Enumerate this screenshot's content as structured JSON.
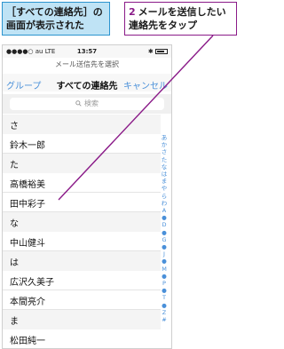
{
  "callouts": {
    "left": "［すべての連絡先］の画面が表示された",
    "right_num": "2",
    "right": "メールを送信したい連絡先をタップ"
  },
  "status": {
    "carrier": "●●●●○ au  LTE",
    "time": "13:57",
    "right": "✱"
  },
  "prompt": "メール送信先を選択",
  "nav": {
    "left": "グループ",
    "title": "すべての連絡先",
    "right": "キャンセル"
  },
  "search": {
    "placeholder": "検索"
  },
  "list": [
    {
      "type": "section",
      "label": "さ"
    },
    {
      "type": "contact",
      "label": "鈴木一郎"
    },
    {
      "type": "section",
      "label": "た"
    },
    {
      "type": "contact",
      "label": "高橋裕美"
    },
    {
      "type": "contact",
      "label": "田中彩子"
    },
    {
      "type": "section",
      "label": "な"
    },
    {
      "type": "contact",
      "label": "中山健斗"
    },
    {
      "type": "section",
      "label": "は"
    },
    {
      "type": "contact",
      "label": "広沢久美子"
    },
    {
      "type": "contact",
      "label": "本間亮介"
    },
    {
      "type": "section",
      "label": "ま"
    },
    {
      "type": "contact",
      "label": "松田純一"
    }
  ],
  "index": [
    "あ",
    "か",
    "さ",
    "た",
    "な",
    "は",
    "ま",
    "や",
    "ら",
    "わ",
    "A",
    "●",
    "D",
    "●",
    "G",
    "●",
    "J",
    "●",
    "M",
    "●",
    "P",
    "●",
    "T",
    "●",
    "Z",
    "#"
  ],
  "colors": {
    "accent": "#4a90d9",
    "callout_line": "#8a1a88",
    "callout_left_bg": "#bfe3f5"
  }
}
